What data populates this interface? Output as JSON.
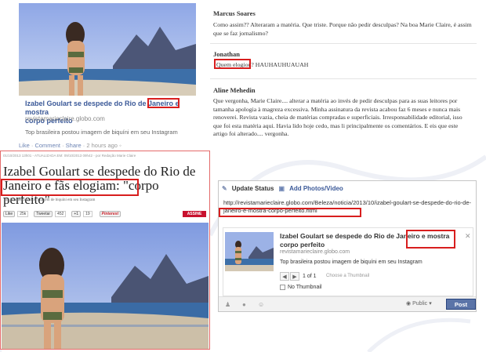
{
  "share_post": {
    "title_part1": "Izabel Goulart se despede do Rio de Janeiro",
    "title_part2": "e mostra",
    "title_part3": "corpo perfeito",
    "url": "revistamarieclaire.globo.com",
    "description": "Top brasileira postou imagem de biquíni em seu Instagram",
    "like": "Like",
    "comment": "Comment",
    "share": "Share",
    "time": "2 hours ago"
  },
  "comments": [
    {
      "name": "Marcus Soares",
      "text": "Como assim?? Alteraram a matéria. Que triste. Porque não pedir desculpas? Na boa Marie Claire, é assim que se faz jornalismo?"
    },
    {
      "name": "Jonathan",
      "text": "Quem elogiou? HAUHAUHUAUAH"
    },
    {
      "name": "Aline Mehedin",
      "text": "Que vergonha, Marie Claire.... alterar a matéria ao invés de pedir desculpas para as suas leitores por tamanha apologia à magreza excessiva. Minha assinatura da revista acabou faz 6 meses e nunca mais renoverei. Revista vazia, cheia de matérias compradas e superficiais. Irresponsabilidade editorial, isso que foi esta matéria aqui. Havia lido hoje cedo, mas li principalmente os comentários. E eis que este artigo foi alterado.... vergonha."
    }
  ],
  "article": {
    "meta": "01/10/2013 13h01 - ATUALIZADA EM: 09/10/2013 09h42 - por Redação Marie Claire",
    "title_line1": "Izabel Goulart se despede do Rio de",
    "title_line2a": "Janeiro e fãs elogiam:",
    "title_line2b": "\"corpo perfeito\"",
    "subtitle": "Top brasileira postou imagem de biquíni em seu Instagram",
    "like_label": "Like",
    "like_count": "25k",
    "tweet_label": "Tweetar",
    "tweet_count": "452",
    "gplus_count": "19",
    "pinterest_label": "Pinterest",
    "subscribe": "ASSINE"
  },
  "update_status": {
    "tab_status": "Update Status",
    "tab_photos": "Add Photos/Video",
    "url_text": "http://revistamarieclaire.globo.com/Beleza/noticia/2013/10/izabel-goulart-se-despede-do-rio-de-janeiro-e-mostra-corpo-perfeito.html",
    "preview_title_part1": "Izabel Goulart se despede do Rio de Janeiro",
    "preview_title_part2": "e mostra",
    "preview_title_part3": "corpo perfeito",
    "preview_url": "revistamarieclaire.globo.com",
    "preview_desc": "Top brasileira postou imagem de biquíni em seu Instagram",
    "pager": "1 of 1",
    "choose_thumb": "Choose a Thumbnail",
    "no_thumb": "No Thumbnail",
    "privacy": "Public",
    "post": "Post"
  },
  "colors": {
    "fb_link": "#3b5998",
    "highlight": "#d81e1e",
    "post_button": "#5b74a8"
  },
  "icons": [
    "update-status-icon",
    "photo-icon",
    "close-icon",
    "prev-icon",
    "next-icon",
    "people-icon",
    "location-icon",
    "emoji-icon",
    "globe-icon",
    "caret-down-icon"
  ]
}
